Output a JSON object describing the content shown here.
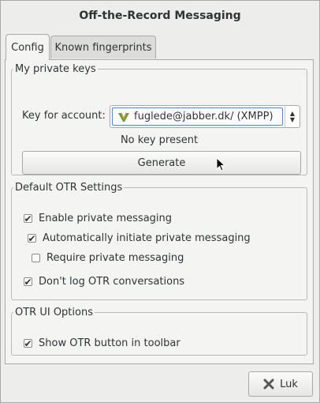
{
  "window": {
    "title": "Off-the-Record Messaging"
  },
  "tabs": [
    {
      "label": "Config",
      "active": true
    },
    {
      "label": "Known fingerprints",
      "active": false
    }
  ],
  "private_keys": {
    "title": "My private keys",
    "account_label": "Key for account:",
    "account_value": "fuglede@jabber.dk/ (XMPP)",
    "status": "No key present",
    "generate_label": "Generate"
  },
  "otr_settings": {
    "title": "Default OTR Settings",
    "enable_private": {
      "label": "Enable private messaging",
      "checked": true
    },
    "auto_initiate": {
      "label": "Automatically initiate private messaging",
      "checked": true
    },
    "require_private": {
      "label": "Require private messaging",
      "checked": false
    },
    "dont_log": {
      "label": "Don't log OTR conversations",
      "checked": true
    }
  },
  "ui_options": {
    "title": "OTR UI Options",
    "show_button": {
      "label": "Show OTR button in toolbar",
      "checked": true
    }
  },
  "footer": {
    "close_label": "Luk"
  },
  "check_mark": "✔",
  "colors": {
    "accent": "#5a84c6",
    "close_icon": "#555753"
  }
}
